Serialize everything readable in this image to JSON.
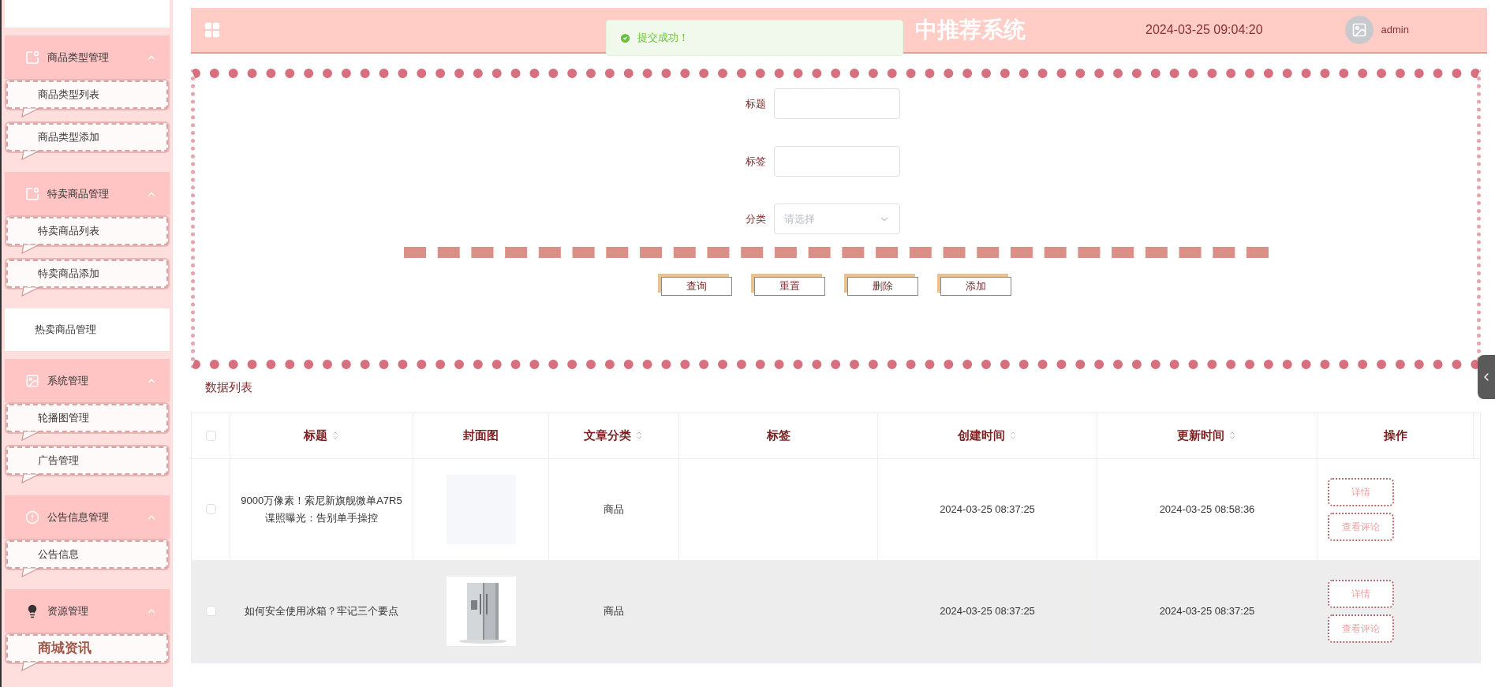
{
  "header": {
    "title": "中推荐系统",
    "datetime": "2024-03-25 09:04:20",
    "user": "admin"
  },
  "toast": {
    "message": "提交成功！"
  },
  "sidebar": {
    "items": [
      {
        "kind": "group",
        "label": "商品类型管理",
        "expanded": true,
        "children": [
          {
            "label": "商品类型列表",
            "emphasized": false
          },
          {
            "label": "商品类型添加",
            "emphasized": false
          }
        ]
      },
      {
        "kind": "group",
        "label": "特卖商品管理",
        "expanded": true,
        "children": [
          {
            "label": "特卖商品列表",
            "emphasized": false
          },
          {
            "label": "特卖商品添加",
            "emphasized": false
          }
        ]
      },
      {
        "kind": "link",
        "label": "热卖商品管理"
      },
      {
        "kind": "group",
        "label": "系统管理",
        "expanded": true,
        "children": [
          {
            "label": "轮播图管理",
            "emphasized": false
          },
          {
            "label": "广告管理",
            "emphasized": false
          }
        ]
      },
      {
        "kind": "group",
        "label": "公告信息管理",
        "expanded": true,
        "children": [
          {
            "label": "公告信息",
            "emphasized": false
          }
        ]
      },
      {
        "kind": "group",
        "label": "资源管理",
        "expanded": true,
        "children": [
          {
            "label": "商城资讯",
            "emphasized": true
          }
        ]
      }
    ]
  },
  "search_form": {
    "fields": [
      {
        "kind": "text",
        "label": "标题"
      },
      {
        "kind": "text",
        "label": "标签"
      },
      {
        "kind": "select",
        "label": "分类",
        "placeholder": "请选择"
      }
    ],
    "buttons": [
      "查询",
      "重置",
      "删除",
      "添加"
    ]
  },
  "table": {
    "title": "数据列表",
    "select_all": false,
    "columns": [
      {
        "label": "标题",
        "sortable": true
      },
      {
        "label": "封面图",
        "sortable": false
      },
      {
        "label": "文章分类",
        "sortable": true
      },
      {
        "label": "标签",
        "sortable": false
      },
      {
        "label": "创建时间",
        "sortable": true
      },
      {
        "label": "更新时间",
        "sortable": true
      },
      {
        "label": "操作",
        "sortable": false
      }
    ],
    "rows": [
      {
        "selected": false,
        "highlighted": false,
        "title": "9000万像素！索尼新旗舰微单A7R5谍照曝光：告别单手操控",
        "cover": {
          "kind": "empty"
        },
        "category": "商品",
        "created": "2024-03-25 08:37:25",
        "updated": "2024-03-25 08:58:36",
        "actions": [
          "详情",
          "查看评论"
        ]
      },
      {
        "selected": false,
        "highlighted": true,
        "title": "如何安全使用冰箱？牢记三个要点",
        "cover": {
          "kind": "picture"
        },
        "category": "商品",
        "created": "2024-03-25 08:37:25",
        "updated": "2024-03-25 08:37:25",
        "actions": [
          "详情",
          "查看评论"
        ]
      }
    ]
  }
}
